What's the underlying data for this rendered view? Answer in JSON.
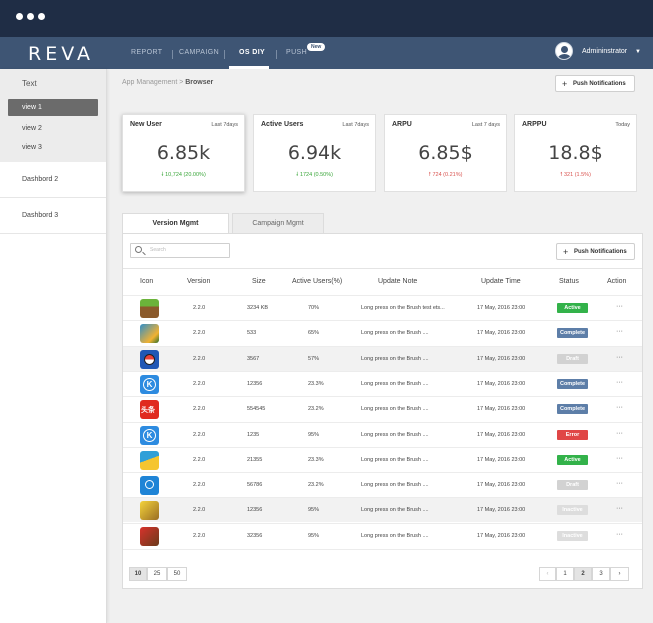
{
  "app": {
    "logo": "REVA"
  },
  "nav": {
    "items": [
      {
        "label": "REPORT"
      },
      {
        "label": "CAMPAIGN"
      },
      {
        "label": "OS DIY"
      },
      {
        "label": "PUSH"
      }
    ],
    "active": "OS DIY",
    "push_badge": "New",
    "user": "Admininstrator"
  },
  "sidebar": {
    "group_label": "Text",
    "views": [
      "view 1",
      "view 2",
      "view 3"
    ],
    "items": [
      "Dashbord 2",
      "Dashbord 3"
    ]
  },
  "breadcrumb": {
    "parent": "App Management >",
    "current": "Browser"
  },
  "header_button": "Push Notifications",
  "cards": [
    {
      "title": "New User",
      "period": "Last 7days",
      "value": "6.85k",
      "delta": "10,724 (20.00%)",
      "trend": "up"
    },
    {
      "title": "Active Users",
      "period": "Last 7days",
      "value": "6.94k",
      "delta": "1724 (0.50%)",
      "trend": "up"
    },
    {
      "title": "ARPU",
      "period": "Last 7 days",
      "value": "6.85$",
      "delta": "724 (0.21%)",
      "trend": "down"
    },
    {
      "title": "ARPPU",
      "period": "Today",
      "value": "18.8$",
      "delta": "321  (1.5%)",
      "trend": "down"
    }
  ],
  "tabs": [
    "Version Mgmt",
    "Campaign Mgmt"
  ],
  "search": {
    "placeholder": "Search"
  },
  "table_button": "Push Notifications",
  "table": {
    "columns": [
      "Icon",
      "Version",
      "Size",
      "Active Users(%)",
      "Update Note",
      "Update Time",
      "Status",
      "Action"
    ],
    "rows": [
      {
        "icon": "minecraft-icon",
        "version": "2.2.0",
        "size": "3234 KB",
        "active": "70%",
        "note": "Long press on the Brush test ets...",
        "time": "17 May, 2016 23:00",
        "status": "Active",
        "action": "···"
      },
      {
        "icon": "clash-game-icon",
        "version": "2.2.0",
        "size": "533",
        "active": "65%",
        "note": "Long press on the Brush ....",
        "time": "17 May, 2016 23:00",
        "status": "Complete",
        "action": "···"
      },
      {
        "icon": "pokeball-icon",
        "version": "2.2.0",
        "size": "3567",
        "active": "57%",
        "note": "Long press on the Brush ....",
        "time": "17 May, 2016 23:00",
        "status": "Draft",
        "action": "···"
      },
      {
        "icon": "k-app-icon",
        "version": "2.2.0",
        "size": "12356",
        "active": "23.3%",
        "note": "Long press on the Brush ....",
        "time": "17 May, 2016 23:00",
        "status": "Complete",
        "action": "···"
      },
      {
        "icon": "toutiao-icon",
        "version": "2.2.0",
        "size": "554545",
        "active": "23.2%",
        "note": "Long press on the Brush ....",
        "time": "17 May, 2016 23:00",
        "status": "Complete",
        "action": "···"
      },
      {
        "icon": "k-app-icon",
        "version": "2.2.0",
        "size": "1235",
        "active": "95%",
        "note": "Long press on the Brush ....",
        "time": "17 May, 2016 23:00",
        "status": "Error",
        "action": "···"
      },
      {
        "icon": "broom-cleaner-icon",
        "version": "2.2.0",
        "size": "21355",
        "active": "23.3%",
        "note": "Long press on the Brush ....",
        "time": "17 May, 2016 23:00",
        "status": "Active",
        "action": "···"
      },
      {
        "icon": "wifi-app-icon",
        "version": "2.2.0",
        "size": "56786",
        "active": "23.2%",
        "note": "Long press on the Brush ....",
        "time": "17 May, 2016 23:00",
        "status": "Draft",
        "action": "···"
      },
      {
        "icon": "pikachu-game-icon",
        "version": "2.2.0",
        "size": "12356",
        "active": "95%",
        "note": "Long press on the Brush ....",
        "time": "17 May, 2016 23:00",
        "status": "Inactive",
        "action": "···"
      },
      {
        "icon": "mario-game-icon",
        "version": "2.2.0",
        "size": "32356",
        "active": "95%",
        "note": "Long press on the Brush ....",
        "time": "17 May, 2016 23:00",
        "status": "Inactive",
        "action": "···"
      }
    ]
  },
  "page_sizes": [
    "10",
    "25",
    "50"
  ],
  "page_size_selected": "10",
  "pagination": {
    "prev": "‹",
    "pages": [
      "1",
      "2",
      "3"
    ],
    "current": "2",
    "next": "›"
  },
  "colors": {
    "titlebar": "#1f2d45",
    "navbar": "#3e5574",
    "active": "#33b24a",
    "complete": "#5d7ea8",
    "error": "#e04646"
  }
}
